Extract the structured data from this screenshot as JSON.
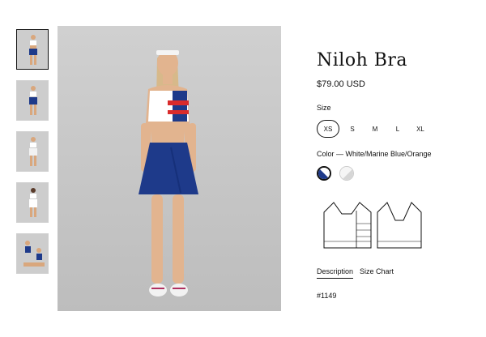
{
  "product": {
    "title": "Niloh Bra",
    "price": "$79.00 USD",
    "size_label": "Size",
    "sizes": [
      "XS",
      "S",
      "M",
      "L",
      "XL"
    ],
    "selected_size": "XS",
    "color_label": "Color — White/Marine Blue/Orange",
    "swatches": [
      "White/Marine Blue/Orange",
      "White/Grey"
    ],
    "sku": "#1149"
  },
  "tabs": [
    "Description",
    "Size Chart"
  ],
  "thumbnails": 5,
  "colors": {
    "navy": "#1e3a8a",
    "red": "#d92b2b",
    "background_gray": "#c9c9c9"
  }
}
